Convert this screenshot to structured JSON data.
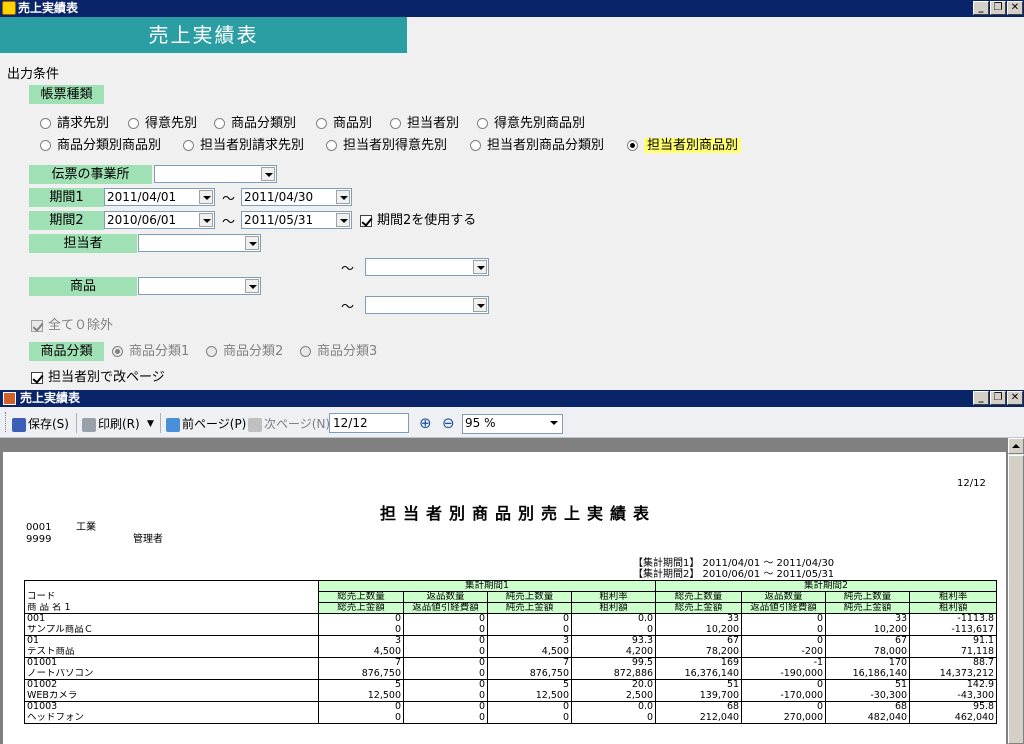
{
  "window": {
    "title": "売上実績表",
    "banner_title": "売上実績表"
  },
  "form": {
    "section_label": "出力条件",
    "report_type": {
      "label": "帳票種類",
      "row1": [
        "請求先別",
        "得意先別",
        "商品分類別",
        "商品別",
        "担当者別",
        "得意先別商品別"
      ],
      "row2": [
        "商品分類別商品別",
        "担当者別請求先別",
        "担当者別得意先別",
        "担当者別商品分類別",
        "担当者別商品別"
      ],
      "selected": "担当者別商品別"
    },
    "office_label": "伝票の事業所",
    "office_value": "",
    "period1_label": "期間1",
    "period1_from": "2011/04/01",
    "period1_to": "2011/04/30",
    "period2_label": "期間2",
    "period2_from": "2010/06/01",
    "period2_to": "2011/05/31",
    "tilde": "〜",
    "use_period2_label": "期間2を使用する",
    "use_period2_checked": true,
    "staff_label": "担当者",
    "product_label": "商品",
    "exclude_zero_label": "全て０除外",
    "category_label": "商品分類",
    "category_options": [
      "商品分類1",
      "商品分類2",
      "商品分類3"
    ],
    "category_selected": "商品分類1",
    "page_break_label": "担当者別で改ページ"
  },
  "viewer": {
    "title": "売上実績表",
    "save_label": "保存(S)",
    "print_label": "印刷(R)",
    "prev_label": "前ページ(P)",
    "next_label": "次ページ(N)",
    "page_value": "12/12",
    "zoom_value": "95 %"
  },
  "report": {
    "page_no": "12/12",
    "title": "担当者別商品別売上実績表",
    "company_code": "0001",
    "company_name": "工業",
    "staff_code": "9999",
    "staff_name": "管理者",
    "period1_caption": "【集計期間1】 2011/04/01 〜 2011/04/30",
    "period2_caption": "【集計期間2】 2010/06/01 〜 2011/05/31",
    "col_code": "コード",
    "col_name": "商 品 名 1",
    "group1": "集計期間1",
    "group2": "集計期間2",
    "h1": [
      "総売上数量",
      "返品数量",
      "純売上数量",
      "粗利率",
      "総売上数量",
      "返品数量",
      "純売上数量",
      "粗利率"
    ],
    "h2": [
      "総売上金額",
      "返品値引経費額",
      "純売上金額",
      "粗利額",
      "総売上金額",
      "返品値引経費額",
      "純売上金額",
      "粗利額"
    ],
    "rows": [
      {
        "code": "001",
        "name": "サンプル商品Ｃ",
        "a": [
          "0",
          "0",
          "0",
          "0.0",
          "33",
          "0",
          "33",
          "-1113.8"
        ],
        "b": [
          "0",
          "0",
          "0",
          "0",
          "10,200",
          "0",
          "10,200",
          "-113,617"
        ]
      },
      {
        "code": "01",
        "name": "テスト商品",
        "a": [
          "3",
          "0",
          "3",
          "93.3",
          "67",
          "0",
          "67",
          "91.1"
        ],
        "b": [
          "4,500",
          "0",
          "4,500",
          "4,200",
          "78,200",
          "-200",
          "78,000",
          "71,118"
        ]
      },
      {
        "code": "01001",
        "name": "ノートパソコン",
        "a": [
          "7",
          "0",
          "7",
          "99.5",
          "169",
          "-1",
          "170",
          "88.7"
        ],
        "b": [
          "876,750",
          "0",
          "876,750",
          "872,886",
          "16,376,140",
          "-190,000",
          "16,186,140",
          "14,373,212"
        ]
      },
      {
        "code": "01002",
        "name": "WEBカメラ",
        "a": [
          "5",
          "0",
          "5",
          "20.0",
          "51",
          "0",
          "51",
          "142.9"
        ],
        "b": [
          "12,500",
          "0",
          "12,500",
          "2,500",
          "139,700",
          "-170,000",
          "-30,300",
          "-43,300"
        ]
      },
      {
        "code": "01003",
        "name": "ヘッドフォン",
        "a": [
          "0",
          "0",
          "0",
          "0.0",
          "68",
          "0",
          "68",
          "95.8"
        ],
        "b": [
          "0",
          "0",
          "0",
          "0",
          "212,040",
          "270,000",
          "482,040",
          "462,040"
        ]
      }
    ]
  }
}
